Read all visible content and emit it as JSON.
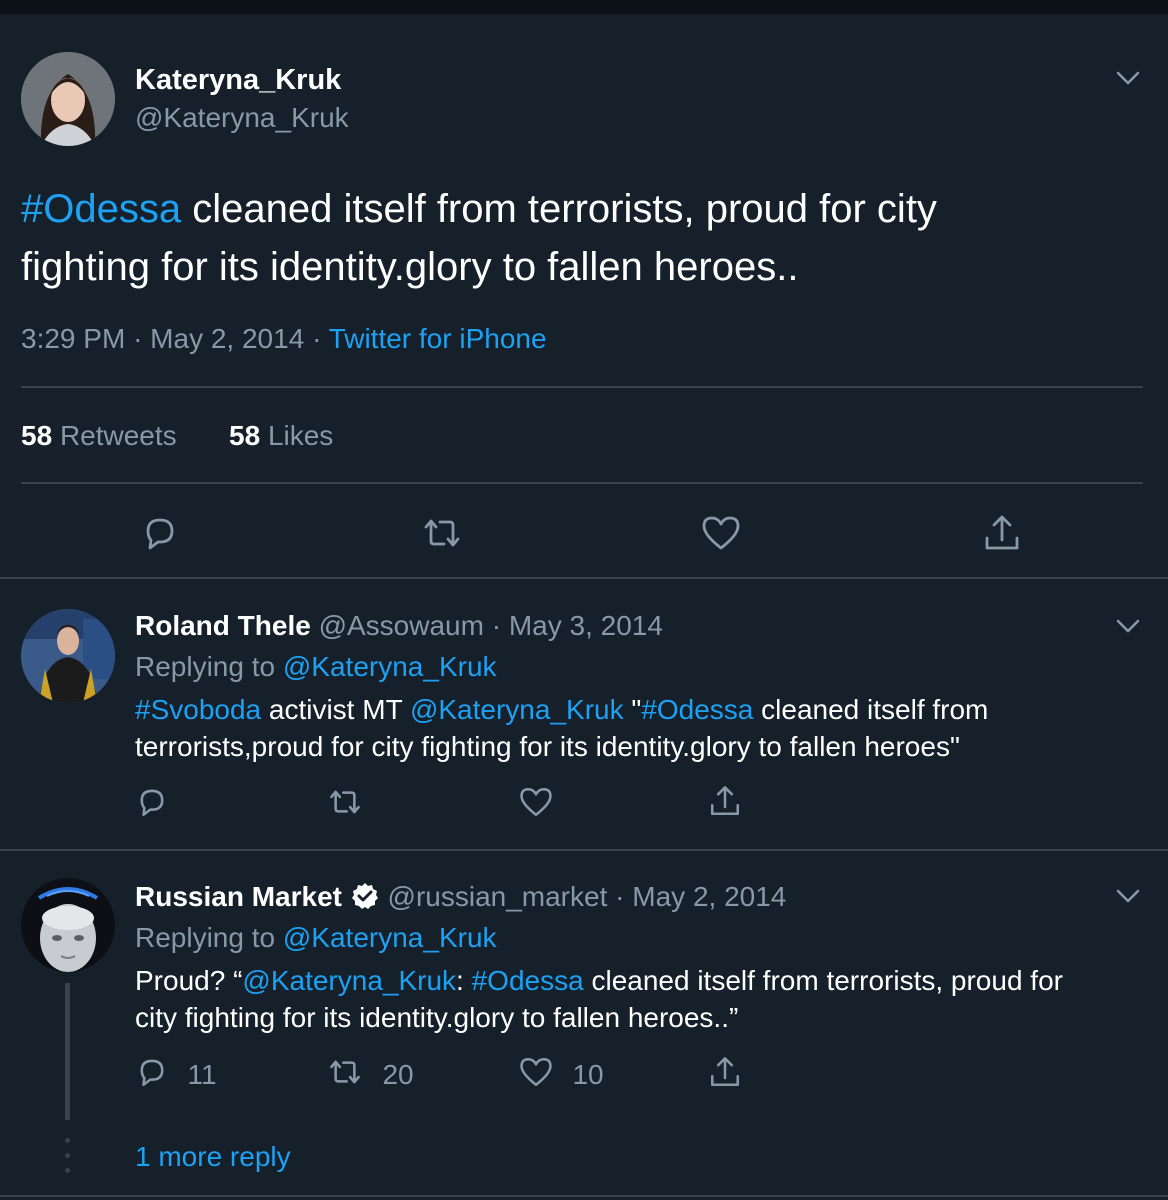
{
  "main_tweet": {
    "display_name": "Kateryna_Kruk",
    "handle": "@Kateryna_Kruk",
    "hashtag": "#Odessa",
    "text_line1_rest": " cleaned itself from terrorists, proud for city",
    "text_line2": "fighting for its identity.glory to fallen heroes..",
    "time": "3:29 PM",
    "date": "May 2, 2014",
    "source": "Twitter for iPhone",
    "sep": "·",
    "retweets_count": "58",
    "retweets_label": "Retweets",
    "likes_count": "58",
    "likes_label": "Likes"
  },
  "reply1": {
    "display_name": "Roland Thele",
    "handle": "@Assowaum",
    "sep": "·",
    "date": "May 3, 2014",
    "replying_prefix": "Replying to",
    "replying_handle": "@Kateryna_Kruk",
    "hashtag1": "#Svoboda",
    "text_a": " activist MT ",
    "mention": "@Kateryna_Kruk",
    "text_b": " \"",
    "hashtag2": "#Odessa",
    "text_c": " cleaned itself from",
    "line2": "terrorists,proud for city fighting for its identity.glory to fallen heroes\""
  },
  "reply2": {
    "display_name": "Russian Market",
    "handle": "@russian_market",
    "sep": "·",
    "date": "May 2, 2014",
    "replying_prefix": "Replying to",
    "replying_handle": "@Kateryna_Kruk",
    "text_a": "Proud? “",
    "mention": "@Kateryna_Kruk",
    "text_b": ": ",
    "hashtag": "#Odessa",
    "text_c": " cleaned itself from terrorists, proud for",
    "line2": "city fighting for its identity.glory to fallen heroes..”",
    "reply_count": "11",
    "retweet_count": "20",
    "like_count": "10"
  },
  "more_replies": "1 more reply",
  "colors": {
    "background": "#15202b",
    "accent": "#1da1f2",
    "muted": "#8899a6",
    "divider": "#38444d"
  },
  "icons": [
    "chevron-down-icon",
    "reply-icon",
    "retweet-icon",
    "like-icon",
    "share-icon",
    "verified-badge-icon"
  ]
}
